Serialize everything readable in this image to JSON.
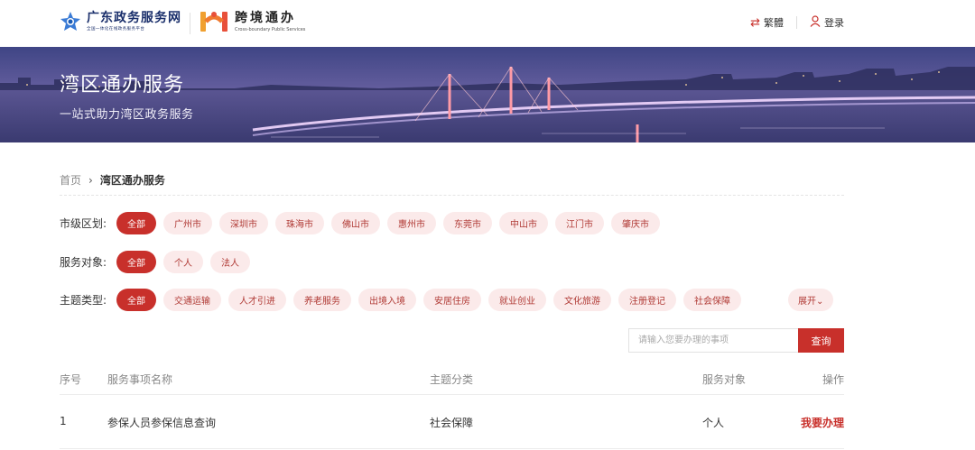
{
  "header": {
    "logo1_title": "广东政务服务网",
    "logo1_subtitle": "全国一体化在线政务服务平台",
    "logo2_title": "跨境通办",
    "logo2_subtitle": "Cross-boundary Public Services",
    "lang_label": "繁體",
    "login_label": "登录",
    "brand_color": "#c8302b"
  },
  "banner": {
    "title": "湾区通办服务",
    "subtitle": "一站式助力湾区政务服务"
  },
  "breadcrumb": {
    "home": "首页",
    "separator": "›",
    "current": "湾区通办服务"
  },
  "filters": {
    "city": {
      "label": "市级区划:",
      "options": [
        "全部",
        "广州市",
        "深圳市",
        "珠海市",
        "佛山市",
        "惠州市",
        "东莞市",
        "中山市",
        "江门市",
        "肇庆市"
      ],
      "selected": "全部"
    },
    "target": {
      "label": "服务对象:",
      "options": [
        "全部",
        "个人",
        "法人"
      ],
      "selected": "全部"
    },
    "topic": {
      "label": "主题类型:",
      "options": [
        "全部",
        "交通运输",
        "人才引进",
        "养老服务",
        "出境入境",
        "安居住房",
        "就业创业",
        "文化旅游",
        "注册登记",
        "社会保障"
      ],
      "selected": "全部",
      "expand_label": "展开⌄"
    }
  },
  "search": {
    "placeholder": "请输入您要办理的事项",
    "button_label": "查询"
  },
  "table": {
    "columns": [
      "序号",
      "服务事项名称",
      "主题分类",
      "服务对象",
      "操作"
    ],
    "rows": [
      {
        "index": "1",
        "name": "参保人员参保信息查询",
        "topic": "社会保障",
        "target": "个人",
        "action": "我要办理"
      }
    ]
  }
}
